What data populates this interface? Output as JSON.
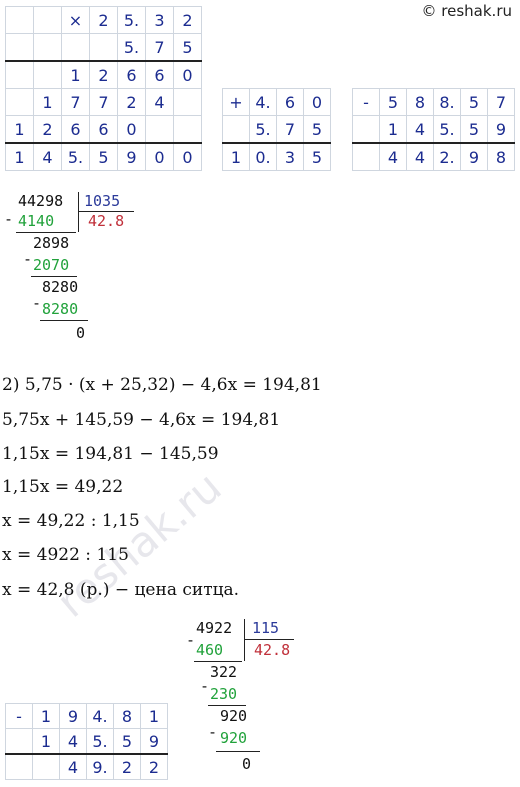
{
  "watermark": "© reshak.ru",
  "faded_watermark": "reshak.ru",
  "mult_table": [
    [
      "",
      "",
      "×",
      "2",
      "5.",
      "3",
      "2"
    ],
    [
      "",
      "",
      "",
      "",
      "5.",
      "7",
      "5"
    ],
    [
      "",
      "",
      "1",
      "2",
      "6",
      "6",
      "0"
    ],
    [
      "",
      "1",
      "7",
      "7",
      "2",
      "4",
      ""
    ],
    [
      "1",
      "2",
      "6",
      "6",
      "0",
      "",
      ""
    ],
    [
      "1",
      "4",
      "5.",
      "5",
      "9",
      "0",
      "0"
    ]
  ],
  "add_table": [
    [
      "+",
      "4.",
      "6",
      "0"
    ],
    [
      "",
      "5.",
      "7",
      "5"
    ],
    [
      "1",
      "0.",
      "3",
      "5"
    ]
  ],
  "sub_table1": [
    [
      "-",
      "5",
      "8",
      "8.",
      "5",
      "7"
    ],
    [
      "",
      "1",
      "4",
      "5.",
      "5",
      "9"
    ],
    [
      "",
      "4",
      "4",
      "2.",
      "9",
      "8"
    ]
  ],
  "div1": {
    "dividend": "44298",
    "divisor": "1035",
    "quotient": "42.8",
    "s1": "4140",
    "r1": "2898",
    "s2": "2070",
    "r2": "8280",
    "s3": "8280",
    "r3": "0",
    "minus": "-"
  },
  "equations": [
    "2) 5,75 · (x + 25,32) − 4,6x = 194,81",
    "5,75x + 145,59 − 4,6x = 194,81",
    "1,15x = 194,81 − 145,59",
    "1,15x = 49,22",
    "x = 49,22 : 1,15",
    "x = 4922 : 115",
    "x = 42,8 (р.) − цена ситца."
  ],
  "div2": {
    "dividend": "4922",
    "divisor": "115",
    "quotient": "42.8",
    "s1": "460",
    "r1": "322",
    "s2": "230",
    "r2": "920",
    "s3": "920",
    "r3": "0",
    "minus": "-"
  },
  "sub_table2": [
    [
      "-",
      "1",
      "9",
      "4.",
      "8",
      "1"
    ],
    [
      "",
      "1",
      "4",
      "5.",
      "5",
      "9"
    ],
    [
      "",
      "",
      "4",
      "9.",
      "2",
      "2"
    ]
  ]
}
